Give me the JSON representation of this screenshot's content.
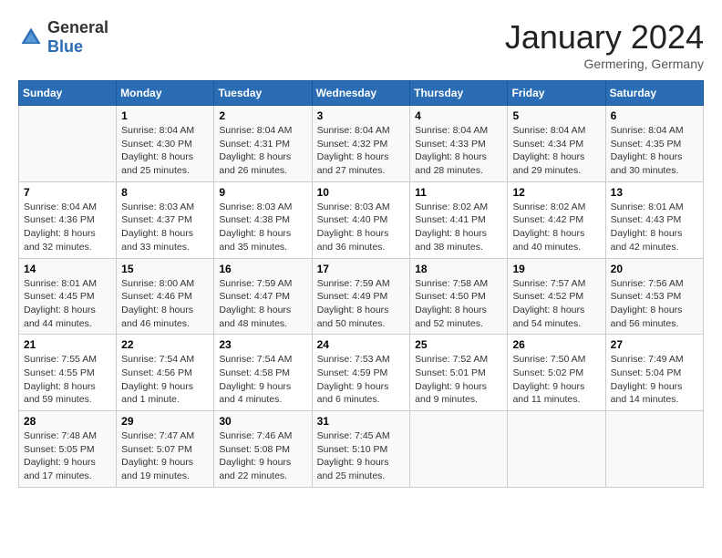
{
  "header": {
    "logo_general": "General",
    "logo_blue": "Blue",
    "month_title": "January 2024",
    "location": "Germering, Germany"
  },
  "days_of_week": [
    "Sunday",
    "Monday",
    "Tuesday",
    "Wednesday",
    "Thursday",
    "Friday",
    "Saturday"
  ],
  "weeks": [
    [
      {
        "day": "",
        "sunrise": "",
        "sunset": "",
        "daylight": ""
      },
      {
        "day": "1",
        "sunrise": "Sunrise: 8:04 AM",
        "sunset": "Sunset: 4:30 PM",
        "daylight": "Daylight: 8 hours and 25 minutes."
      },
      {
        "day": "2",
        "sunrise": "Sunrise: 8:04 AM",
        "sunset": "Sunset: 4:31 PM",
        "daylight": "Daylight: 8 hours and 26 minutes."
      },
      {
        "day": "3",
        "sunrise": "Sunrise: 8:04 AM",
        "sunset": "Sunset: 4:32 PM",
        "daylight": "Daylight: 8 hours and 27 minutes."
      },
      {
        "day": "4",
        "sunrise": "Sunrise: 8:04 AM",
        "sunset": "Sunset: 4:33 PM",
        "daylight": "Daylight: 8 hours and 28 minutes."
      },
      {
        "day": "5",
        "sunrise": "Sunrise: 8:04 AM",
        "sunset": "Sunset: 4:34 PM",
        "daylight": "Daylight: 8 hours and 29 minutes."
      },
      {
        "day": "6",
        "sunrise": "Sunrise: 8:04 AM",
        "sunset": "Sunset: 4:35 PM",
        "daylight": "Daylight: 8 hours and 30 minutes."
      }
    ],
    [
      {
        "day": "7",
        "sunrise": "Sunrise: 8:04 AM",
        "sunset": "Sunset: 4:36 PM",
        "daylight": "Daylight: 8 hours and 32 minutes."
      },
      {
        "day": "8",
        "sunrise": "Sunrise: 8:03 AM",
        "sunset": "Sunset: 4:37 PM",
        "daylight": "Daylight: 8 hours and 33 minutes."
      },
      {
        "day": "9",
        "sunrise": "Sunrise: 8:03 AM",
        "sunset": "Sunset: 4:38 PM",
        "daylight": "Daylight: 8 hours and 35 minutes."
      },
      {
        "day": "10",
        "sunrise": "Sunrise: 8:03 AM",
        "sunset": "Sunset: 4:40 PM",
        "daylight": "Daylight: 8 hours and 36 minutes."
      },
      {
        "day": "11",
        "sunrise": "Sunrise: 8:02 AM",
        "sunset": "Sunset: 4:41 PM",
        "daylight": "Daylight: 8 hours and 38 minutes."
      },
      {
        "day": "12",
        "sunrise": "Sunrise: 8:02 AM",
        "sunset": "Sunset: 4:42 PM",
        "daylight": "Daylight: 8 hours and 40 minutes."
      },
      {
        "day": "13",
        "sunrise": "Sunrise: 8:01 AM",
        "sunset": "Sunset: 4:43 PM",
        "daylight": "Daylight: 8 hours and 42 minutes."
      }
    ],
    [
      {
        "day": "14",
        "sunrise": "Sunrise: 8:01 AM",
        "sunset": "Sunset: 4:45 PM",
        "daylight": "Daylight: 8 hours and 44 minutes."
      },
      {
        "day": "15",
        "sunrise": "Sunrise: 8:00 AM",
        "sunset": "Sunset: 4:46 PM",
        "daylight": "Daylight: 8 hours and 46 minutes."
      },
      {
        "day": "16",
        "sunrise": "Sunrise: 7:59 AM",
        "sunset": "Sunset: 4:47 PM",
        "daylight": "Daylight: 8 hours and 48 minutes."
      },
      {
        "day": "17",
        "sunrise": "Sunrise: 7:59 AM",
        "sunset": "Sunset: 4:49 PM",
        "daylight": "Daylight: 8 hours and 50 minutes."
      },
      {
        "day": "18",
        "sunrise": "Sunrise: 7:58 AM",
        "sunset": "Sunset: 4:50 PM",
        "daylight": "Daylight: 8 hours and 52 minutes."
      },
      {
        "day": "19",
        "sunrise": "Sunrise: 7:57 AM",
        "sunset": "Sunset: 4:52 PM",
        "daylight": "Daylight: 8 hours and 54 minutes."
      },
      {
        "day": "20",
        "sunrise": "Sunrise: 7:56 AM",
        "sunset": "Sunset: 4:53 PM",
        "daylight": "Daylight: 8 hours and 56 minutes."
      }
    ],
    [
      {
        "day": "21",
        "sunrise": "Sunrise: 7:55 AM",
        "sunset": "Sunset: 4:55 PM",
        "daylight": "Daylight: 8 hours and 59 minutes."
      },
      {
        "day": "22",
        "sunrise": "Sunrise: 7:54 AM",
        "sunset": "Sunset: 4:56 PM",
        "daylight": "Daylight: 9 hours and 1 minute."
      },
      {
        "day": "23",
        "sunrise": "Sunrise: 7:54 AM",
        "sunset": "Sunset: 4:58 PM",
        "daylight": "Daylight: 9 hours and 4 minutes."
      },
      {
        "day": "24",
        "sunrise": "Sunrise: 7:53 AM",
        "sunset": "Sunset: 4:59 PM",
        "daylight": "Daylight: 9 hours and 6 minutes."
      },
      {
        "day": "25",
        "sunrise": "Sunrise: 7:52 AM",
        "sunset": "Sunset: 5:01 PM",
        "daylight": "Daylight: 9 hours and 9 minutes."
      },
      {
        "day": "26",
        "sunrise": "Sunrise: 7:50 AM",
        "sunset": "Sunset: 5:02 PM",
        "daylight": "Daylight: 9 hours and 11 minutes."
      },
      {
        "day": "27",
        "sunrise": "Sunrise: 7:49 AM",
        "sunset": "Sunset: 5:04 PM",
        "daylight": "Daylight: 9 hours and 14 minutes."
      }
    ],
    [
      {
        "day": "28",
        "sunrise": "Sunrise: 7:48 AM",
        "sunset": "Sunset: 5:05 PM",
        "daylight": "Daylight: 9 hours and 17 minutes."
      },
      {
        "day": "29",
        "sunrise": "Sunrise: 7:47 AM",
        "sunset": "Sunset: 5:07 PM",
        "daylight": "Daylight: 9 hours and 19 minutes."
      },
      {
        "day": "30",
        "sunrise": "Sunrise: 7:46 AM",
        "sunset": "Sunset: 5:08 PM",
        "daylight": "Daylight: 9 hours and 22 minutes."
      },
      {
        "day": "31",
        "sunrise": "Sunrise: 7:45 AM",
        "sunset": "Sunset: 5:10 PM",
        "daylight": "Daylight: 9 hours and 25 minutes."
      },
      {
        "day": "",
        "sunrise": "",
        "sunset": "",
        "daylight": ""
      },
      {
        "day": "",
        "sunrise": "",
        "sunset": "",
        "daylight": ""
      },
      {
        "day": "",
        "sunrise": "",
        "sunset": "",
        "daylight": ""
      }
    ]
  ]
}
